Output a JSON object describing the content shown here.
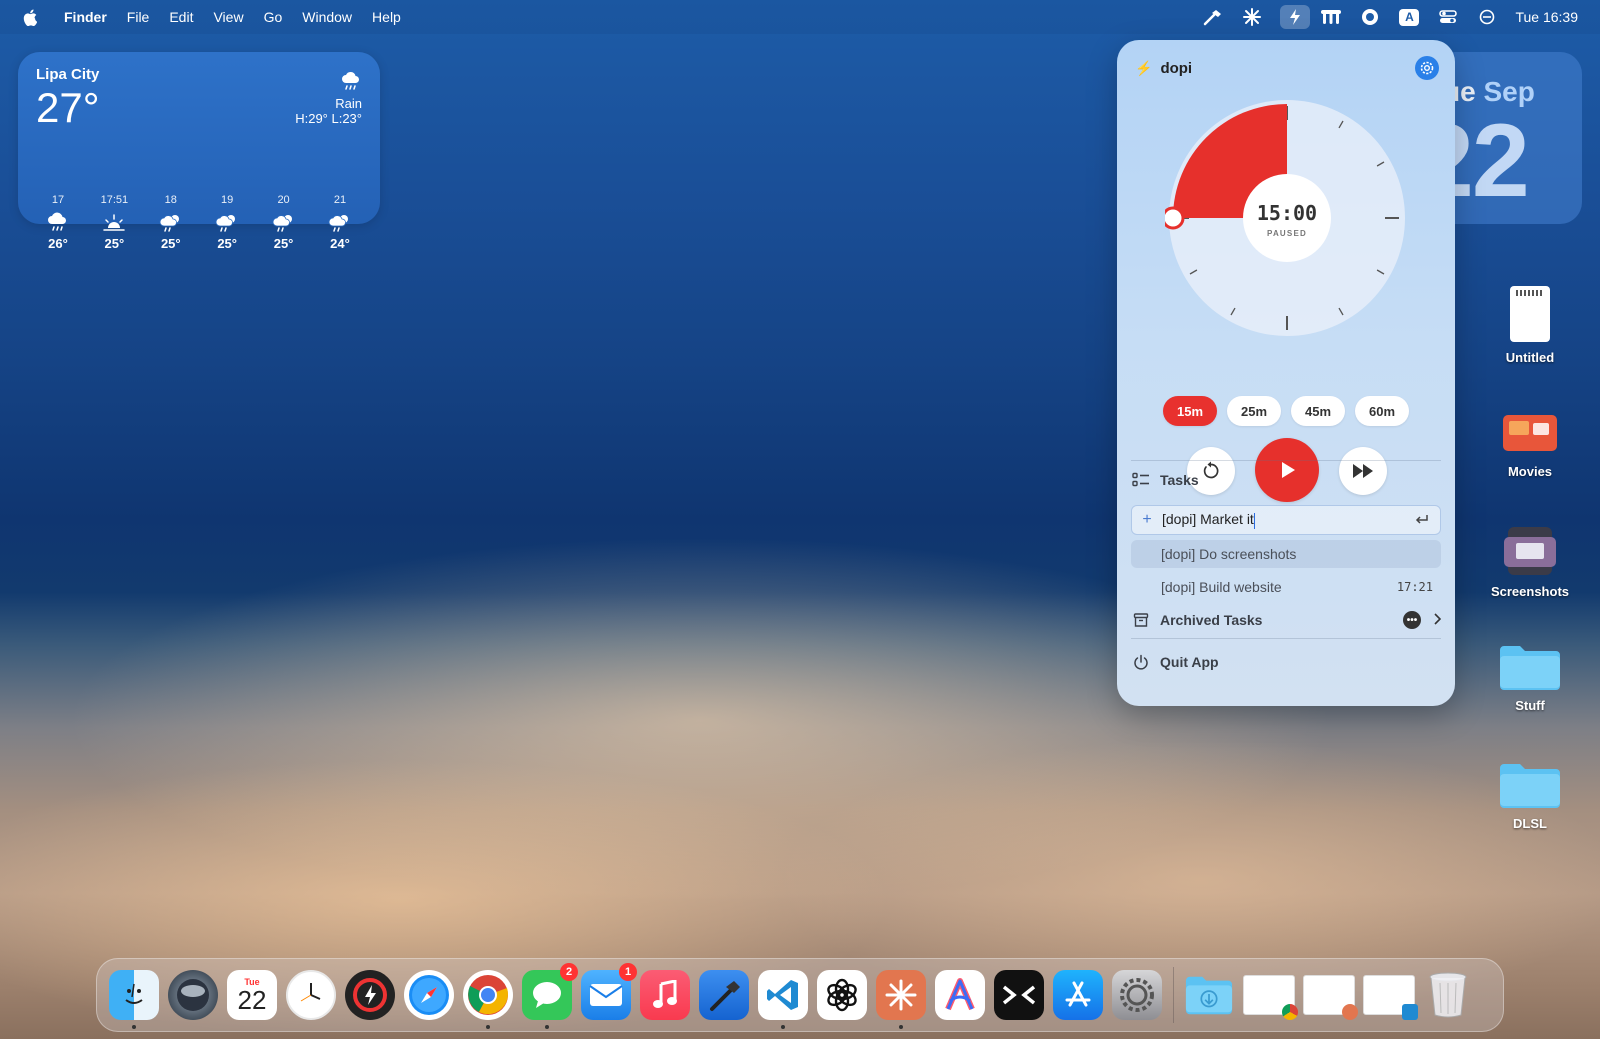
{
  "menubar": {
    "app_name": "Finder",
    "menus": [
      "File",
      "Edit",
      "View",
      "Go",
      "Window",
      "Help"
    ],
    "status_icons": [
      "hammer-icon",
      "claude-icon",
      "bolt-icon",
      "menu-app-icon",
      "record-icon",
      "keyboard-input-icon",
      "control-center-icon",
      "focus-icon"
    ],
    "input_source_label": "A",
    "clock": "Tue 16:39"
  },
  "weather": {
    "city": "Lipa City",
    "temperature": "27°",
    "condition": "Rain",
    "high_low": "H:29° L:23°",
    "forecast": [
      {
        "hour": "17",
        "icon": "rain-cloud-icon",
        "temp": "26°"
      },
      {
        "hour": "17:51",
        "icon": "sunset-icon",
        "temp": "25°"
      },
      {
        "hour": "18",
        "icon": "cloud-sun-rain-icon",
        "temp": "25°"
      },
      {
        "hour": "19",
        "icon": "cloud-sun-rain-icon",
        "temp": "25°"
      },
      {
        "hour": "20",
        "icon": "cloud-sun-rain-icon",
        "temp": "25°"
      },
      {
        "hour": "21",
        "icon": "cloud-sun-rain-icon",
        "temp": "24°"
      }
    ]
  },
  "calendar_widget": {
    "weekday": "Tue",
    "month": "Sep",
    "day": "22"
  },
  "dopi": {
    "title": "dopi",
    "timer_display": "15:00",
    "timer_status": "PAUSED",
    "timer_progress_fraction": 0.25,
    "presets": [
      {
        "label": "15m",
        "active": true
      },
      {
        "label": "25m",
        "active": false
      },
      {
        "label": "45m",
        "active": false
      },
      {
        "label": "60m",
        "active": false
      }
    ],
    "tasks_heading": "Tasks",
    "task_input_value": "[dopi] Market it",
    "tasks": [
      {
        "label": "[dopi] Do screenshots",
        "time": ""
      },
      {
        "label": "[dopi] Build website",
        "time": "17:21"
      }
    ],
    "archived_label": "Archived Tasks",
    "quit_label": "Quit App",
    "accent_color": "#e6302c"
  },
  "desktop_icons": [
    {
      "label": "Untitled",
      "icon": "document-icon"
    },
    {
      "label": "Movies",
      "icon": "movies-folder-icon"
    },
    {
      "label": "Screenshots",
      "icon": "screenshots-folder-icon"
    },
    {
      "label": "Stuff",
      "icon": "folder-icon"
    },
    {
      "label": "DLSL",
      "icon": "folder-icon"
    }
  ],
  "dock": {
    "calendar_month": "Tue",
    "calendar_day": "22",
    "messages_badge": "2",
    "mail_badge": "1",
    "apps": [
      "Finder",
      "Siri",
      "Calendar",
      "Clock",
      "Activity",
      "Safari",
      "Chrome",
      "Messages",
      "Mail",
      "Music",
      "Xcode",
      "VS Code",
      "ChatGPT",
      "Claude",
      "Arc",
      "Terminal",
      "App Store",
      "System Settings"
    ]
  }
}
